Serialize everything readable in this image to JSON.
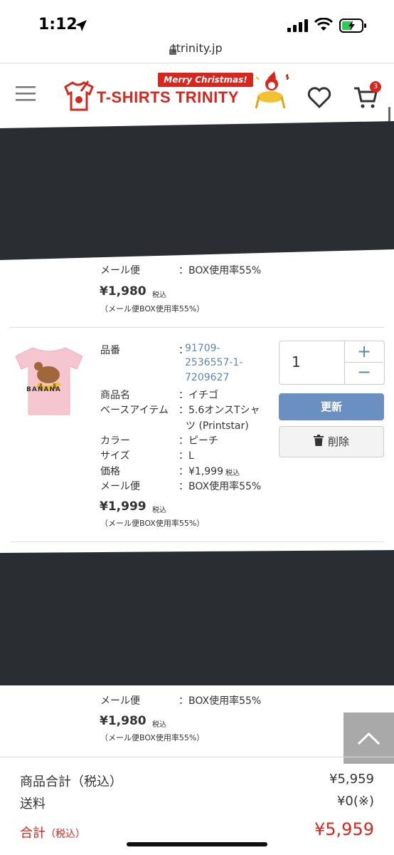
{
  "status": {
    "time": "1:12"
  },
  "browser": {
    "url": "ttrinity.jp"
  },
  "header": {
    "logo": "T-SHIRTS TRINITY",
    "banner": "Merry Christmas!",
    "cart_count": "3"
  },
  "item_top": {
    "mail_label": "メール便",
    "mail_value": "：BOX使用率55%",
    "price": "¥1,980",
    "tax": "税込",
    "note": "（メール便BOX使用率55%）"
  },
  "item_main": {
    "tshirt_text": "BANANA",
    "code_label": "品番",
    "code_colon": "：",
    "code_lines": [
      "91709-",
      "2536557-1-",
      "7209627"
    ],
    "name_label": "商品名",
    "name_value": "：イチゴ",
    "base_label": "ベースアイテム",
    "base_line1": "：5.6オンスTシャ",
    "base_line2": "ツ (Printstar)",
    "color_label": "カラー",
    "color_value": "：ピーチ",
    "size_label": "サイズ",
    "size_value": "：L",
    "unit_label": "価格",
    "unit_value": "：¥1,999",
    "unit_tax": "税込",
    "mail_label": "メール便",
    "mail_value": "：BOX使用率55%",
    "price": "¥1,999",
    "tax": "税込",
    "note": "（メール便BOX使用率55%）",
    "quantity": "1",
    "plus": "+",
    "minus": "−",
    "update_label": "更新",
    "delete_label": "削除"
  },
  "item_bottom": {
    "mail_label": "メール便",
    "mail_value": "：BOX使用率55%",
    "price": "¥1,980",
    "tax": "税込",
    "note": "（メール便BOX使用率55%）"
  },
  "summary": {
    "subtotal_label": "商品合計（税込）",
    "subtotal_value": "¥5,959",
    "shipping_label": "送料",
    "shipping_value": "¥0(※)",
    "total_label": "合計",
    "total_tax": "（税込）",
    "total_value": "¥5,959"
  }
}
